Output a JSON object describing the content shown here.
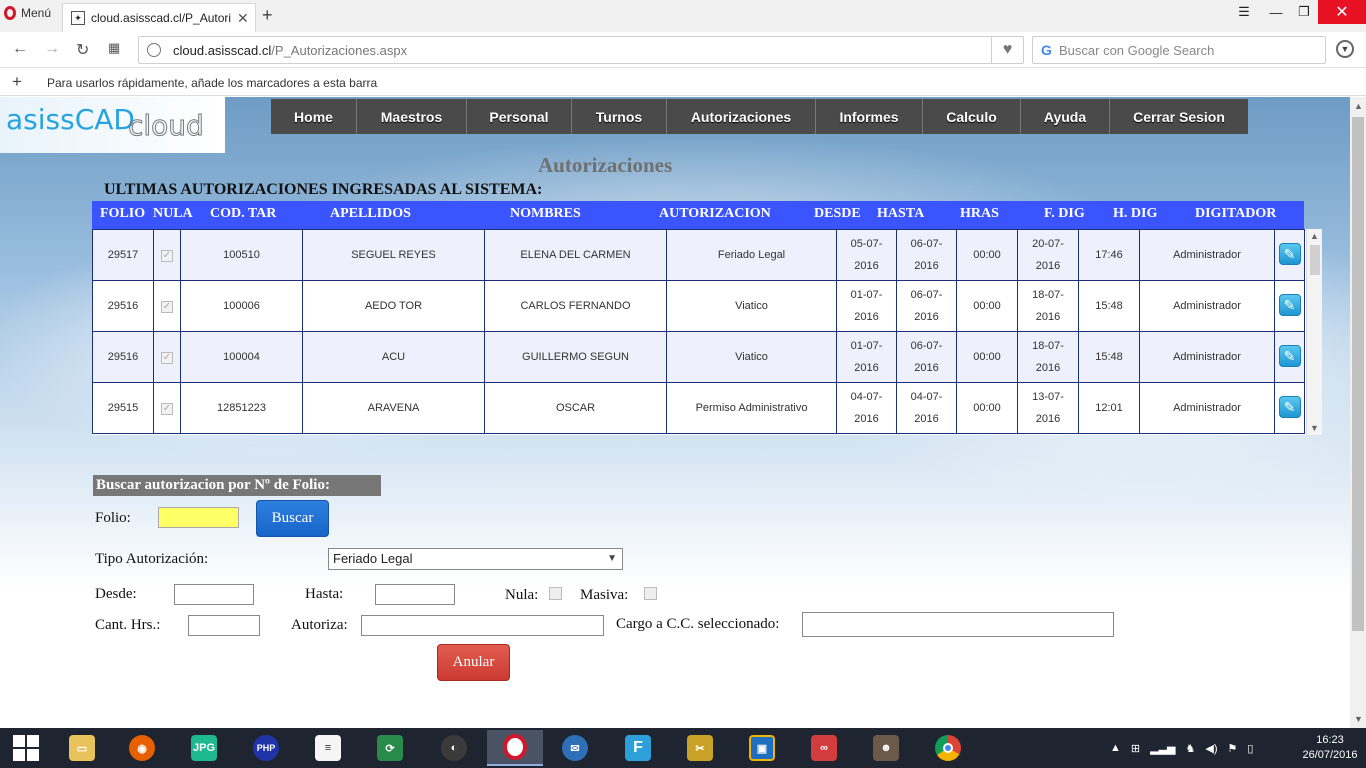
{
  "browser": {
    "menu_label": "Menú",
    "tab_title": "cloud.asisscad.cl/P_Autoriz",
    "url_host": "cloud.asisscad.cl",
    "url_path": "/P_Autorizaciones.aspx",
    "search_placeholder": "Buscar con Google Search",
    "bookmarks_hint": "Para usarlos rápidamente, añade los marcadores a esta barra"
  },
  "logo": {
    "part1": "asissCAD",
    "part2": "cloud"
  },
  "nav": [
    "Home",
    "Maestros",
    "Personal",
    "Turnos",
    "Autorizaciones",
    "Informes",
    "Calculo",
    "Ayuda",
    "Cerrar Sesion"
  ],
  "page": {
    "title": "Autorizaciones",
    "section_title": "ULTIMAS AUTORIZACIONES INGRESADAS AL SISTEMA:"
  },
  "table": {
    "headers": [
      "FOLIO",
      "NULA",
      "COD. TAR",
      "APELLIDOS",
      "NOMBRES",
      "AUTORIZACION",
      "DESDE",
      "HASTA",
      "HRAS",
      "F. DIG",
      "H. DIG",
      "DIGITADOR"
    ],
    "rows": [
      {
        "folio": "29517",
        "nula": "✓",
        "cod": "100510",
        "apellidos": "SEGUEL  REYES",
        "nombres": "ELENA  DEL  CARMEN",
        "autorizacion": "Feriado  Legal",
        "desde1": "05-07-",
        "desde2": "2016",
        "hasta1": "06-07-",
        "hasta2": "2016",
        "hras": "00:00",
        "fdig1": "20-07-",
        "fdig2": "2016",
        "hdig": "17:46",
        "digitador": "Administrador"
      },
      {
        "folio": "29516",
        "nula": "✓",
        "cod": "100006",
        "apellidos": "AEDO  TOR",
        "nombres": "CARLOS  FERNANDO",
        "autorizacion": "Viatico",
        "desde1": "01-07-",
        "desde2": "2016",
        "hasta1": "06-07-",
        "hasta2": "2016",
        "hras": "00:00",
        "fdig1": "18-07-",
        "fdig2": "2016",
        "hdig": "15:48",
        "digitador": "Administrador"
      },
      {
        "folio": "29516",
        "nula": "✓",
        "cod": "100004",
        "apellidos": "ACU",
        "nombres": "GUILLERMO  SEGUN",
        "autorizacion": "Viatico",
        "desde1": "01-07-",
        "desde2": "2016",
        "hasta1": "06-07-",
        "hasta2": "2016",
        "hras": "00:00",
        "fdig1": "18-07-",
        "fdig2": "2016",
        "hdig": "15:48",
        "digitador": "Administrador"
      },
      {
        "folio": "29515",
        "nula": "✓",
        "cod": "12851223",
        "apellidos": "ARAVENA",
        "nombres": "OSCAR",
        "autorizacion": "Permiso  Administrativo",
        "desde1": "04-07-",
        "desde2": "2016",
        "hasta1": "04-07-",
        "hasta2": "2016",
        "hras": "00:00",
        "fdig1": "13-07-",
        "fdig2": "2016",
        "hdig": "12:01",
        "digitador": "Administrador"
      }
    ]
  },
  "form": {
    "search_header": "Buscar autorizacion por Nº de Folio:",
    "folio_label": "Folio:",
    "folio_value": "",
    "buscar_label": "Buscar",
    "tipo_label": "Tipo Autorización:",
    "tipo_value": "Feriado Legal",
    "desde_label": "Desde:",
    "hasta_label": "Hasta:",
    "nula_label": "Nula:",
    "masiva_label": "Masiva:",
    "cant_label": "Cant. Hrs.:",
    "autoriza_label": "Autoriza:",
    "cargo_label": "Cargo a C.C. seleccionado:",
    "anular_label": "Anular"
  },
  "taskbar": {
    "time": "16:23",
    "date": "26/07/2016",
    "apps": [
      "file-explorer",
      "firefox",
      "jpg-viewer",
      "php",
      "document",
      "excel-sync",
      "dark-app",
      "opera",
      "thunderbird",
      "flash",
      "tools",
      "virtualbox",
      "infinity",
      "game",
      "chrome"
    ]
  }
}
